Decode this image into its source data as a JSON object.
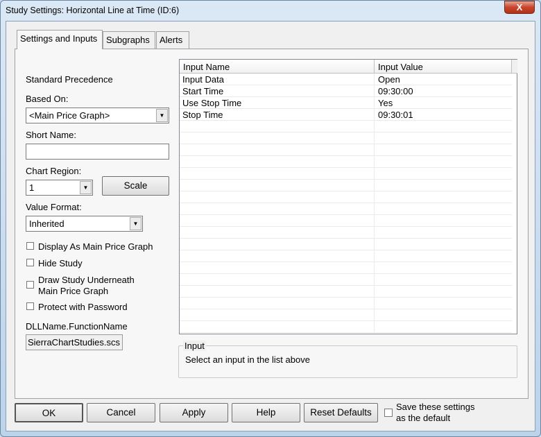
{
  "window": {
    "title": "Study Settings: Horizontal Line at Time (ID:6)",
    "close_label": "X"
  },
  "tabs": [
    {
      "label": "Settings and Inputs"
    },
    {
      "label": "Subgraphs"
    },
    {
      "label": "Alerts"
    }
  ],
  "left": {
    "standard_precedence": "Standard Precedence",
    "based_on_label": "Based On:",
    "based_on_value": "<Main Price Graph>",
    "short_name_label": "Short Name:",
    "short_name_value": "",
    "chart_region_label": "Chart Region:",
    "chart_region_value": "1",
    "scale_button": "Scale",
    "value_format_label": "Value Format:",
    "value_format_value": "Inherited",
    "checkboxes": [
      {
        "label": "Display As Main Price Graph",
        "checked": false
      },
      {
        "label": "Hide Study",
        "checked": false
      },
      {
        "label": "Draw Study Underneath",
        "label2": "Main Price Graph",
        "checked": false
      },
      {
        "label": "Protect with Password",
        "checked": false
      }
    ],
    "dll_label": "DLLName.FunctionName",
    "dll_value": "SierraChartStudies.scs"
  },
  "grid": {
    "headers": [
      "Input Name",
      "Input Value"
    ],
    "rows": [
      [
        "Input Data",
        "Open"
      ],
      [
        "Start Time",
        "09:30:00"
      ],
      [
        "Use Stop Time",
        "Yes"
      ],
      [
        "Stop Time",
        "09:30:01"
      ]
    ]
  },
  "input_group": {
    "title": "Input",
    "text": "Select an input in the list above"
  },
  "footer": {
    "ok": "OK",
    "cancel": "Cancel",
    "apply": "Apply",
    "help": "Help",
    "reset": "Reset Defaults",
    "save_default_line1": "Save these settings",
    "save_default_line2": "as the default"
  }
}
